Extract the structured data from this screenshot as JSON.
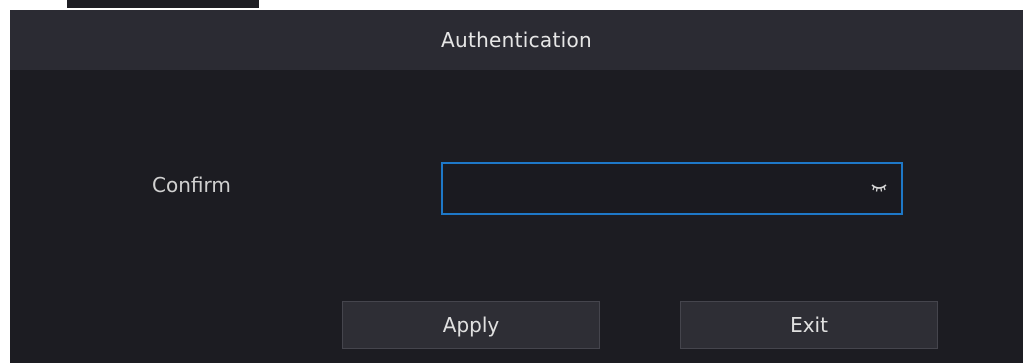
{
  "dialog": {
    "title": "Authentication",
    "field": {
      "label": "Confirm",
      "value": "",
      "visibility_icon": "eye-closed-icon"
    },
    "buttons": {
      "apply": "Apply",
      "exit": "Exit"
    }
  },
  "colors": {
    "background": "#1c1c22",
    "titlebar": "#2b2b33",
    "field_border_focus": "#1e78c8",
    "button_bg": "#2e2e35"
  }
}
